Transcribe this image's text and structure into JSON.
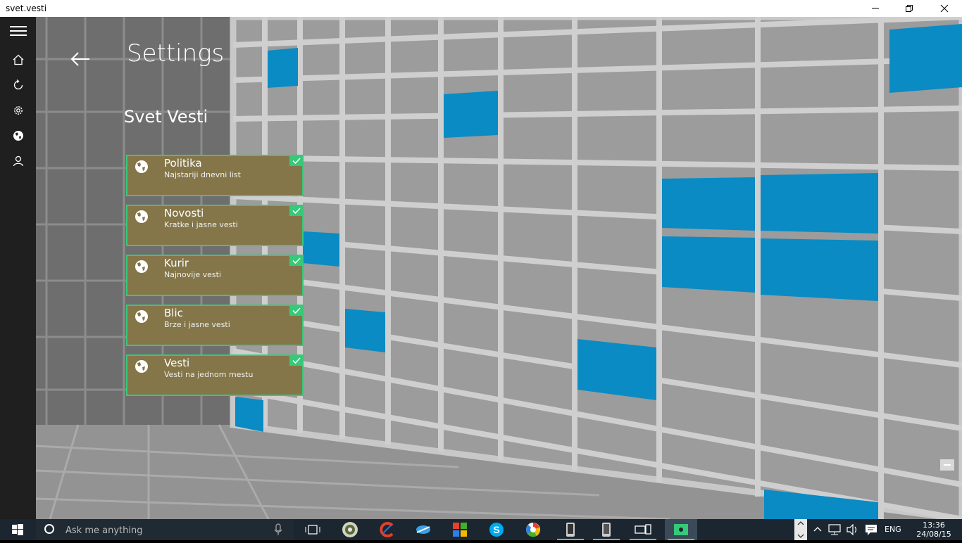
{
  "window": {
    "title": "svet.vesti"
  },
  "nav": {
    "items": [
      "home-icon",
      "refresh-icon",
      "settings-icon",
      "globe-icon",
      "person-icon"
    ]
  },
  "page": {
    "title": "Settings",
    "section": "Svet Vesti"
  },
  "sources": [
    {
      "name": "Politika",
      "description": "Najstariji dnevni list",
      "selected": true
    },
    {
      "name": "Novosti",
      "description": "Kratke i jasne vesti",
      "selected": true
    },
    {
      "name": "Kurir",
      "description": "Najnovije vesti",
      "selected": true
    },
    {
      "name": "Blic",
      "description": "Brze i jasne vesti",
      "selected": true
    },
    {
      "name": "Vesti",
      "description": "Vesti na jednom mestu",
      "selected": true
    }
  ],
  "taskbar": {
    "search_placeholder": "Ask me anything",
    "apps": [
      "task-view-icon",
      "media-player-icon",
      "ccleaner-icon",
      "browser-icon",
      "store-icon",
      "skype-icon",
      "picasa-icon",
      "phone-app-icon",
      "tablet-app-icon",
      "devices-icon",
      "svet-vesti-icon"
    ],
    "language": "ENG",
    "time": "13:36",
    "date": "24/08/15"
  },
  "colors": {
    "card": "#847649",
    "accent": "#35c978",
    "tile_blue": "#0a8bc4"
  }
}
